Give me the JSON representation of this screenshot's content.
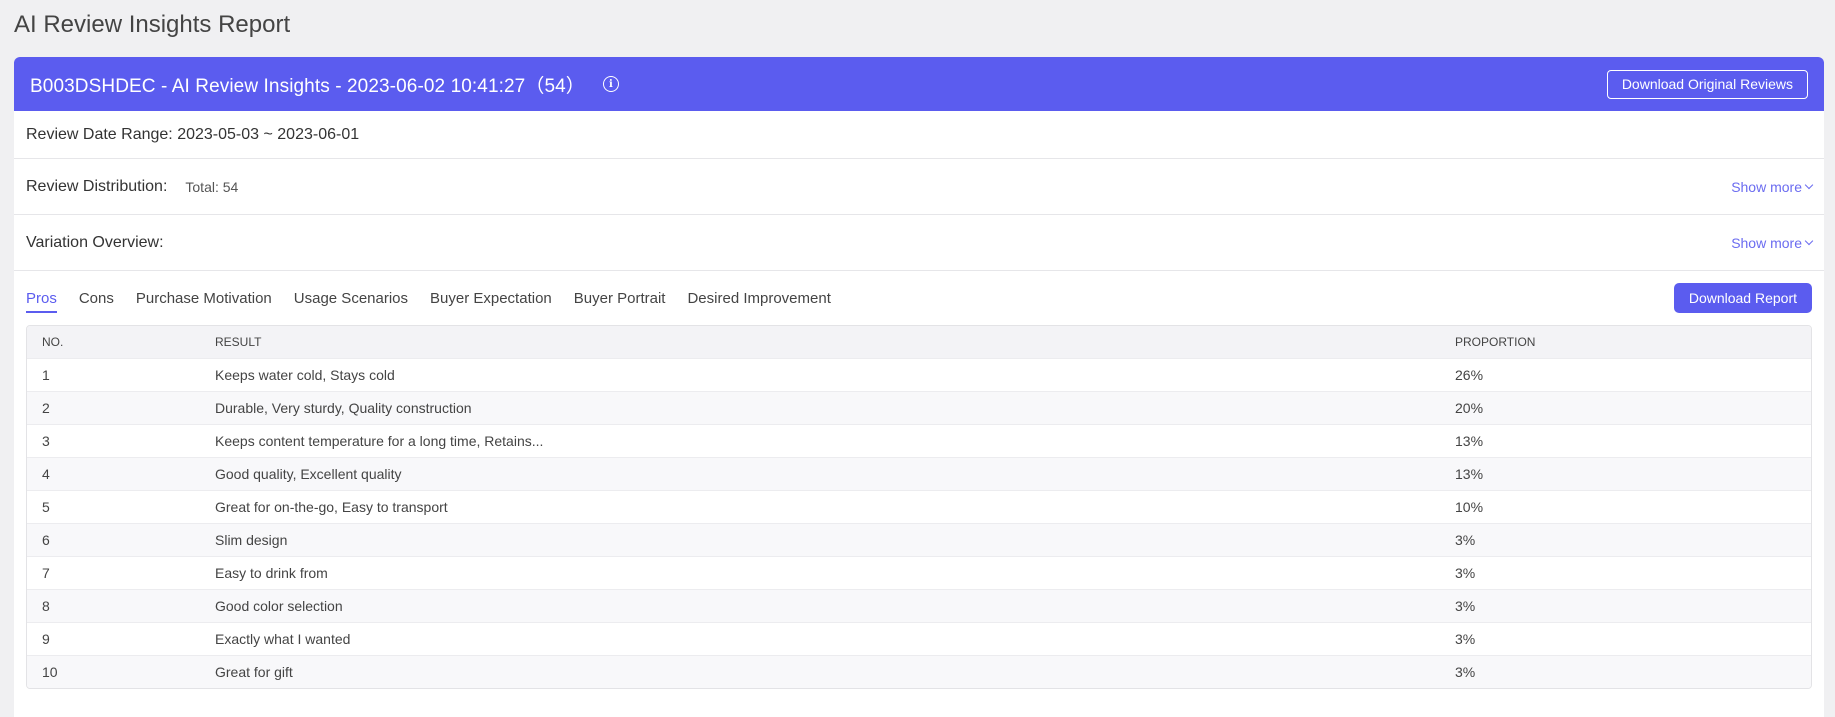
{
  "page": {
    "title": "AI Review Insights Report"
  },
  "header": {
    "title": "B003DSHDEC - AI Review Insights - 2023-06-02 10:41:27（54）",
    "info_icon": "info-icon",
    "download_original_label": "Download Original Reviews"
  },
  "review_range": {
    "text": "Review Date Range: 2023-05-03 ~ 2023-06-01"
  },
  "distribution": {
    "label": "Review Distribution:",
    "total": "Total: 54",
    "show_more": "Show more"
  },
  "variation": {
    "label": "Variation Overview:",
    "show_more": "Show more"
  },
  "tabs": [
    {
      "label": "Pros",
      "active": true
    },
    {
      "label": "Cons"
    },
    {
      "label": "Purchase Motivation"
    },
    {
      "label": "Usage Scenarios"
    },
    {
      "label": "Buyer Expectation"
    },
    {
      "label": "Buyer Portrait"
    },
    {
      "label": "Desired Improvement"
    }
  ],
  "download_report_label": "Download Report",
  "table": {
    "headers": {
      "no": "NO.",
      "result": "RESULT",
      "proportion": "PROPORTION"
    },
    "rows": [
      {
        "no": "1",
        "result": "Keeps water cold, Stays cold",
        "proportion": "26%"
      },
      {
        "no": "2",
        "result": "Durable, Very sturdy, Quality construction",
        "proportion": "20%"
      },
      {
        "no": "3",
        "result": "Keeps content temperature for a long time, Retains...",
        "proportion": "13%"
      },
      {
        "no": "4",
        "result": "Good quality, Excellent quality",
        "proportion": "13%"
      },
      {
        "no": "5",
        "result": "Great for on-the-go, Easy to transport",
        "proportion": "10%"
      },
      {
        "no": "6",
        "result": "Slim design",
        "proportion": "3%"
      },
      {
        "no": "7",
        "result": "Easy to drink from",
        "proportion": "3%"
      },
      {
        "no": "8",
        "result": "Good color selection",
        "proportion": "3%"
      },
      {
        "no": "9",
        "result": "Exactly what I wanted",
        "proportion": "3%"
      },
      {
        "no": "10",
        "result": "Great for gift",
        "proportion": "3%"
      }
    ]
  },
  "colors": {
    "accent": "#5b5cef",
    "background": "#f0f0f2"
  }
}
